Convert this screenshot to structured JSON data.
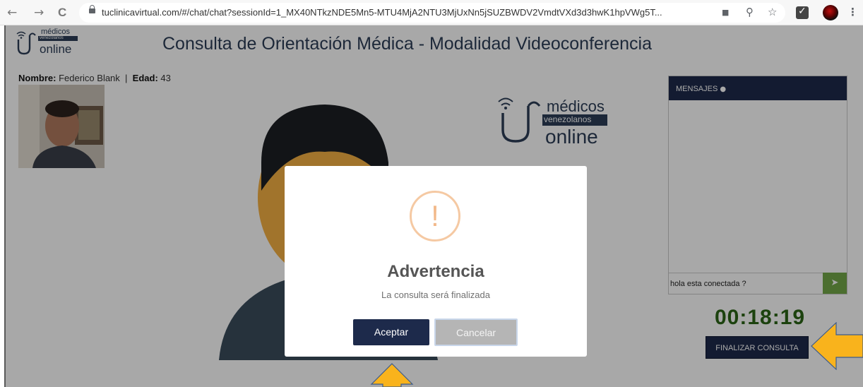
{
  "browser": {
    "url": "tuclinicavirtual.com/#/chat/chat?sessionId=1_MX40NTkzNDE5Mn5-MTU4MjA2NTU3MjUxNn5jSUZBWDV2VmdtVXd3d3hwK1hpVWg5T...",
    "back_icon": "←",
    "forward_icon": "→",
    "reload_icon": "C",
    "camera_icon": "■",
    "zoom_icon": "⚲",
    "star_icon": "☆",
    "menu_icon": "⋮"
  },
  "header": {
    "logo_small": {
      "line1": "médicos",
      "line2": "venezolanos",
      "line3": "online"
    },
    "title": "Consulta de Orientación Médica - Modalidad Videoconferencia"
  },
  "patient": {
    "name_label": "Nombre:",
    "name": "Federico Blank",
    "separator": "|",
    "age_label": "Edad:",
    "age": "43"
  },
  "logo_big": {
    "line1": "médicos",
    "line2": "venezolanos",
    "line3": "online"
  },
  "chat": {
    "header": "MENSAJES",
    "input_value": "hola esta conectada ?",
    "send_icon": "➤"
  },
  "timer": "00:18:19",
  "finish_button": "FINALIZAR CONSULTA",
  "modal": {
    "icon": "!",
    "title": "Advertencia",
    "message": "La consulta será finalizada",
    "accept": "Aceptar",
    "cancel": "Cancelar"
  },
  "colors": {
    "navy": "#1d2a4b",
    "timer_green": "#2b6416",
    "send_green": "#72a848",
    "annotation_arrow": "#f9b31c"
  }
}
